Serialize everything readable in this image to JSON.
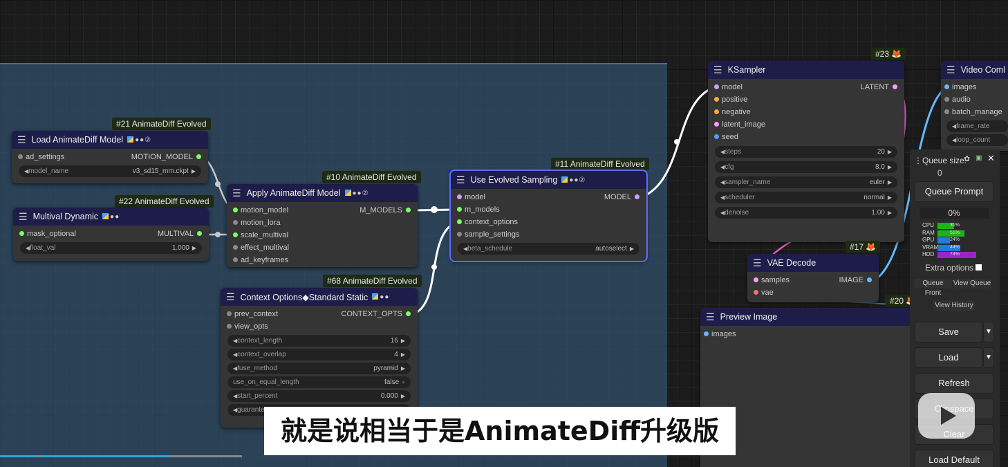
{
  "colors": {
    "link_model": "#c9a0ff",
    "link_white": "#ffffff",
    "node_header": "#1e1d4a",
    "group_bg": "#30506e",
    "cpu": "#1db31d",
    "ram": "#1db31d",
    "gpu": "#1e7be0",
    "vram": "#1e7be0",
    "hdd": "#9b24c9"
  },
  "nodes": {
    "load_model": {
      "badge": "#21 AnimateDiff Evolved",
      "title": "Load AnimateDiff Model",
      "input": "ad_settings",
      "output": "MOTION_MODEL",
      "widget_label": "model_name",
      "widget_value": "v3_sd15_mm.ckpt"
    },
    "multival": {
      "badge": "#22 AnimateDiff Evolved",
      "title": "Multival Dynamic",
      "input": "mask_optional",
      "output": "MULTIVAL",
      "widget_label": "float_val",
      "widget_value": "1.000"
    },
    "apply_model": {
      "badge": "#10 AnimateDiff Evolved",
      "title": "Apply AnimateDiff Model",
      "inputs": [
        "motion_model",
        "motion_lora",
        "scale_multival",
        "effect_multival",
        "ad_keyframes"
      ],
      "output": "M_MODELS"
    },
    "context": {
      "badge": "#68 AnimateDiff Evolved",
      "title": "Context Options◆Standard Static",
      "inputs": [
        "prev_context",
        "view_opts"
      ],
      "output": "CONTEXT_OPTS",
      "widgets": [
        {
          "label": "context_length",
          "value": "16"
        },
        {
          "label": "context_overlap",
          "value": "4"
        },
        {
          "label": "fuse_method",
          "value": "pyramid"
        },
        {
          "label": "use_on_equal_length",
          "value": "false"
        },
        {
          "label": "start_percent",
          "value": "0.000"
        },
        {
          "label": "guarante",
          "value": ""
        }
      ]
    },
    "evolved_sampling": {
      "badge": "#11 AnimateDiff Evolved",
      "title": "Use Evolved Sampling",
      "inputs": [
        "model",
        "m_models",
        "context_options",
        "sample_settings"
      ],
      "output": "MODEL",
      "widget_label": "beta_schedule",
      "widget_value": "autoselect"
    },
    "ksampler": {
      "badge": "#23",
      "title": "KSampler",
      "inputs": [
        "model",
        "positive",
        "negative",
        "latent_image",
        "seed"
      ],
      "output": "LATENT",
      "widgets": [
        {
          "label": "steps",
          "value": "20"
        },
        {
          "label": "cfg",
          "value": "8.0"
        },
        {
          "label": "sampler_name",
          "value": "euler"
        },
        {
          "label": "scheduler",
          "value": "normal"
        },
        {
          "label": "denoise",
          "value": "1.00"
        }
      ]
    },
    "vae_decode": {
      "badge": "#17",
      "title": "VAE Decode",
      "inputs": [
        "samples",
        "vae"
      ],
      "output": "IMAGE"
    },
    "preview": {
      "badge": "#20",
      "title": "Preview Image",
      "input": "images"
    },
    "video_combine": {
      "title": "Video Coml",
      "inputs": [
        "images",
        "audio",
        "batch_manage"
      ],
      "widgets": [
        "frame_rate",
        "loop_count"
      ]
    }
  },
  "panel": {
    "queue_size_label": "Queue size:",
    "queue_size": "0",
    "queue_prompt": "Queue Prompt",
    "progress": "0%",
    "stats": [
      {
        "label": "CPU",
        "value": "31%",
        "pct": 31
      },
      {
        "label": "RAM",
        "value": "51%",
        "pct": 51
      },
      {
        "label": "GPU",
        "value": "24%",
        "pct": 24
      },
      {
        "label": "VRAM",
        "value": "44%",
        "pct": 44
      },
      {
        "label": "HDD",
        "value": "74%",
        "pct": 74
      }
    ],
    "extra_options": "Extra options",
    "queue_front": "Queue Front",
    "view_queue": "View Queue",
    "view_history": "View History",
    "save": "Save",
    "load": "Load",
    "refresh": "Refresh",
    "clipspace": "Clipspace",
    "clear": "Clear",
    "load_default": "Load Default"
  },
  "subtitle": "就是说相当于是AnimateDiff升级版",
  "icons": [
    "menu-icon",
    "gear-icon",
    "image-icon",
    "close-icon",
    "fox-icon",
    "play-icon"
  ]
}
